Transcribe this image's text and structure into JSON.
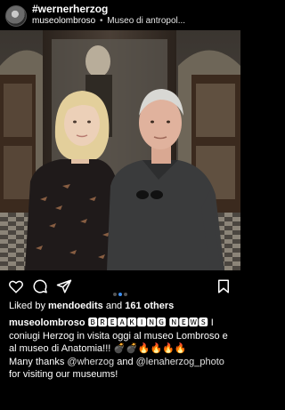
{
  "post": {
    "hashtag": "#wernerherzog",
    "account": "museolombroso",
    "separator": "•",
    "location": "Museo di antropol..."
  },
  "photo": {
    "description": "Two people standing in front of a museum display case"
  },
  "actions": {
    "like_icon": "heart-icon",
    "comment_icon": "comment-icon",
    "share_icon": "send-icon",
    "save_icon": "bookmark-icon",
    "carousel_count": 3,
    "carousel_active": 2
  },
  "likes": {
    "prefix": "Liked by ",
    "first_user": "mendoedits",
    "middle": " and ",
    "others": "161 others"
  },
  "caption": {
    "username": "museolombroso",
    "breaking_news": "🅱🆁🅴🅰🅺🅸🅽🅶 🅽🅴🆆🆂",
    "line1_rest": " I coniugi Herzog in visita oggi al museo Lombroso e al museo di Anatomia!!! 💣💣🔥🔥🔥🔥",
    "thanks_prefix": "Many thanks ",
    "mention1": "@wherzog",
    "and_text": " and ",
    "mention2": "@lenaherzog_photo",
    "thanks_suffix": " for visiting our museums!"
  },
  "colors": {
    "background": "#000000",
    "text": "#ffffff",
    "carousel_active": "#3d8ef0",
    "carousel_inactive": "#555555"
  }
}
